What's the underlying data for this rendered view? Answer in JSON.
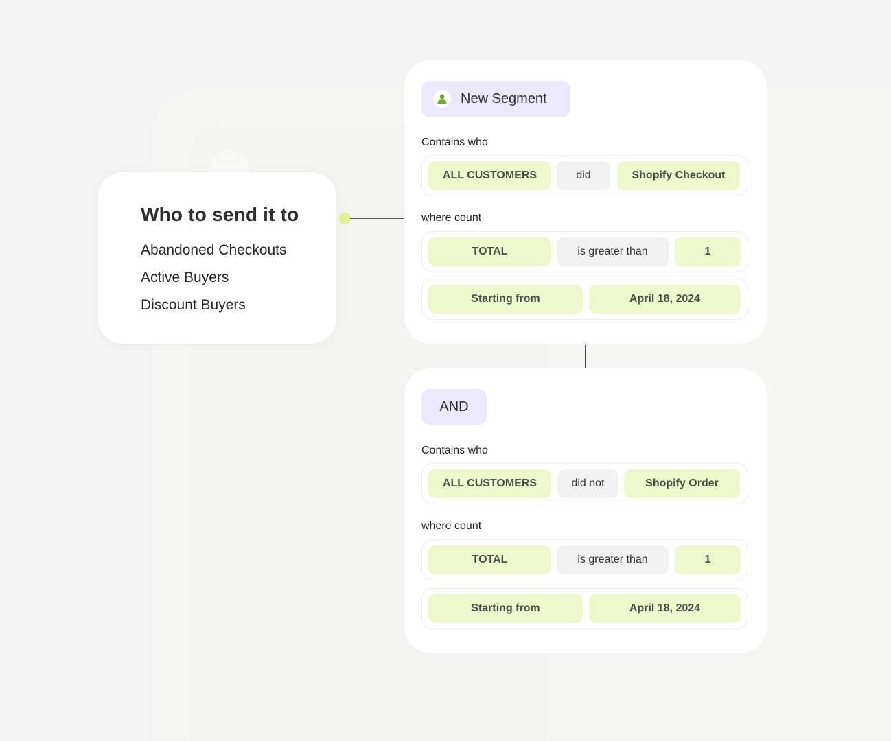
{
  "audience": {
    "title": "Who to send it to",
    "items": [
      "Abandoned Checkouts",
      "Active Buyers",
      "Discount Buyers"
    ]
  },
  "segment1": {
    "header": "New Segment",
    "contains_label": "Contains who",
    "contains": {
      "who": "ALL CUSTOMERS",
      "verb": "did",
      "event": "Shopify Checkout"
    },
    "where_label": "where count",
    "count": {
      "metric": "TOTAL",
      "operator": "is greater than",
      "value": "1"
    },
    "start": {
      "label": "Starting from",
      "date": "April 18, 2024"
    }
  },
  "segment2": {
    "header": "AND",
    "contains_label": "Contains who",
    "contains": {
      "who": "ALL CUSTOMERS",
      "verb": "did not",
      "event": "Shopify Order"
    },
    "where_label": "where count",
    "count": {
      "metric": "TOTAL",
      "operator": "is greater than",
      "value": "1"
    },
    "start": {
      "label": "Starting from",
      "date": "April 18, 2024"
    }
  },
  "colors": {
    "accent_green": "#dff38f",
    "pill_green": "#eff7cc",
    "header_purple": "#ebe9fb",
    "icon_green": "#6aa82d"
  },
  "icons": {
    "segment_header": "user-icon"
  }
}
